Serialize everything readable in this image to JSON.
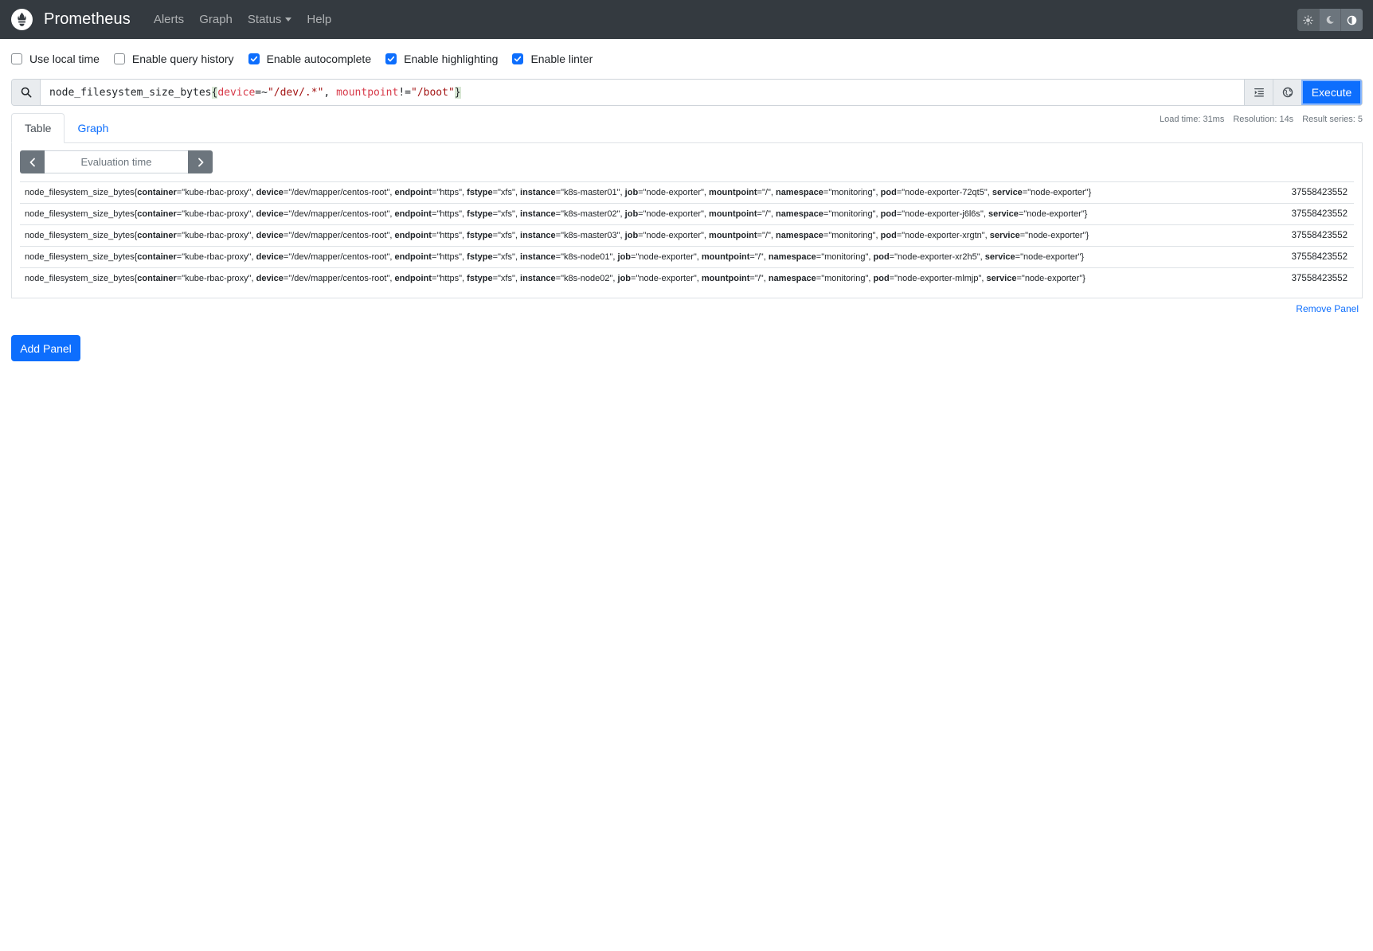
{
  "navbar": {
    "brand": "Prometheus",
    "links": [
      {
        "label": "Alerts"
      },
      {
        "label": "Graph"
      },
      {
        "label": "Status"
      },
      {
        "label": "Help"
      }
    ],
    "theme_icons": [
      "sun-icon",
      "moon-icon",
      "half-circle-icon"
    ]
  },
  "options": [
    {
      "label": "Use local time",
      "checked": false
    },
    {
      "label": "Enable query history",
      "checked": false
    },
    {
      "label": "Enable autocomplete",
      "checked": true
    },
    {
      "label": "Enable highlighting",
      "checked": true
    },
    {
      "label": "Enable linter",
      "checked": true
    }
  ],
  "query": {
    "metric": "node_filesystem_size_bytes",
    "open_brace": "{",
    "label1": "device",
    "op1": "=~",
    "val1": "\"/dev/.*\"",
    "sep": ", ",
    "label2": "mountpoint",
    "op2": "!=",
    "val2": "\"/boot\"",
    "close_brace": "}",
    "execute_label": "Execute"
  },
  "panel": {
    "tabs": [
      {
        "label": "Table",
        "active": true
      },
      {
        "label": "Graph",
        "active": false
      }
    ],
    "stats": {
      "load_time": "Load time: 31ms",
      "resolution": "Resolution: 14s",
      "result_series": "Result series: 5"
    },
    "eval_placeholder": "Evaluation time",
    "remove_label": "Remove Panel",
    "results": [
      {
        "metric": "node_filesystem_size_bytes",
        "labels": [
          {
            "k": "container",
            "v": "kube-rbac-proxy"
          },
          {
            "k": "device",
            "v": "/dev/mapper/centos-root"
          },
          {
            "k": "endpoint",
            "v": "https"
          },
          {
            "k": "fstype",
            "v": "xfs"
          },
          {
            "k": "instance",
            "v": "k8s-master01"
          },
          {
            "k": "job",
            "v": "node-exporter"
          },
          {
            "k": "mountpoint",
            "v": "/"
          },
          {
            "k": "namespace",
            "v": "monitoring"
          },
          {
            "k": "pod",
            "v": "node-exporter-72qt5"
          },
          {
            "k": "service",
            "v": "node-exporter"
          }
        ],
        "value": "37558423552"
      },
      {
        "metric": "node_filesystem_size_bytes",
        "labels": [
          {
            "k": "container",
            "v": "kube-rbac-proxy"
          },
          {
            "k": "device",
            "v": "/dev/mapper/centos-root"
          },
          {
            "k": "endpoint",
            "v": "https"
          },
          {
            "k": "fstype",
            "v": "xfs"
          },
          {
            "k": "instance",
            "v": "k8s-master02"
          },
          {
            "k": "job",
            "v": "node-exporter"
          },
          {
            "k": "mountpoint",
            "v": "/"
          },
          {
            "k": "namespace",
            "v": "monitoring"
          },
          {
            "k": "pod",
            "v": "node-exporter-j6l6s"
          },
          {
            "k": "service",
            "v": "node-exporter"
          }
        ],
        "value": "37558423552"
      },
      {
        "metric": "node_filesystem_size_bytes",
        "labels": [
          {
            "k": "container",
            "v": "kube-rbac-proxy"
          },
          {
            "k": "device",
            "v": "/dev/mapper/centos-root"
          },
          {
            "k": "endpoint",
            "v": "https"
          },
          {
            "k": "fstype",
            "v": "xfs"
          },
          {
            "k": "instance",
            "v": "k8s-master03"
          },
          {
            "k": "job",
            "v": "node-exporter"
          },
          {
            "k": "mountpoint",
            "v": "/"
          },
          {
            "k": "namespace",
            "v": "monitoring"
          },
          {
            "k": "pod",
            "v": "node-exporter-xrgtn"
          },
          {
            "k": "service",
            "v": "node-exporter"
          }
        ],
        "value": "37558423552"
      },
      {
        "metric": "node_filesystem_size_bytes",
        "labels": [
          {
            "k": "container",
            "v": "kube-rbac-proxy"
          },
          {
            "k": "device",
            "v": "/dev/mapper/centos-root"
          },
          {
            "k": "endpoint",
            "v": "https"
          },
          {
            "k": "fstype",
            "v": "xfs"
          },
          {
            "k": "instance",
            "v": "k8s-node01"
          },
          {
            "k": "job",
            "v": "node-exporter"
          },
          {
            "k": "mountpoint",
            "v": "/"
          },
          {
            "k": "namespace",
            "v": "monitoring"
          },
          {
            "k": "pod",
            "v": "node-exporter-xr2h5"
          },
          {
            "k": "service",
            "v": "node-exporter"
          }
        ],
        "value": "37558423552"
      },
      {
        "metric": "node_filesystem_size_bytes",
        "labels": [
          {
            "k": "container",
            "v": "kube-rbac-proxy"
          },
          {
            "k": "device",
            "v": "/dev/mapper/centos-root"
          },
          {
            "k": "endpoint",
            "v": "https"
          },
          {
            "k": "fstype",
            "v": "xfs"
          },
          {
            "k": "instance",
            "v": "k8s-node02"
          },
          {
            "k": "job",
            "v": "node-exporter"
          },
          {
            "k": "mountpoint",
            "v": "/"
          },
          {
            "k": "namespace",
            "v": "monitoring"
          },
          {
            "k": "pod",
            "v": "node-exporter-mlmjp"
          },
          {
            "k": "service",
            "v": "node-exporter"
          }
        ],
        "value": "37558423552"
      }
    ]
  },
  "add_panel_label": "Add Panel",
  "colors": {
    "navbar_bg": "#343a40",
    "primary": "#0d6efd",
    "secondary": "#6c757d"
  }
}
